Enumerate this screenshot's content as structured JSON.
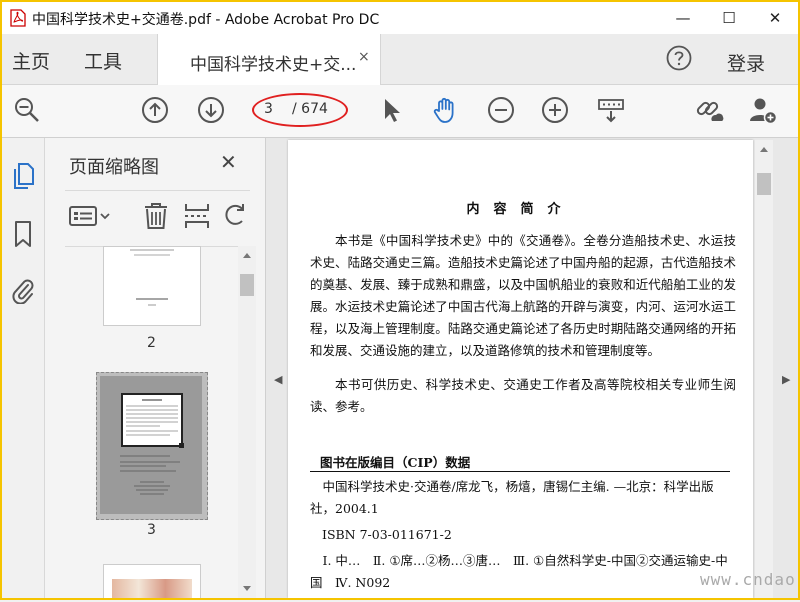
{
  "window": {
    "title": "中国科学技术史+交通卷.pdf - Adobe Acrobat Pro DC",
    "minimize": "—",
    "maximize": "☐",
    "close": "✕"
  },
  "tabs": {
    "home": "主页",
    "tools": "工具",
    "document": "中国科学技术史+交...",
    "document_close": "×",
    "login": "登录"
  },
  "toolbar": {
    "page_current": "3",
    "page_total": "/ 674",
    "accent_color": "#2b72c8",
    "annotation_color": "#e02020"
  },
  "panel": {
    "title": "页面缩略图",
    "close": "✕",
    "thumbnails": [
      {
        "label": "2"
      },
      {
        "label": "3"
      }
    ]
  },
  "document": {
    "heading": "内容简介",
    "paragraph1": "本书是《中国科学技术史》中的《交通卷》。全卷分造船技术史、水运技术史、陆路交通史三篇。造船技术史篇论述了中国舟船的起源，古代造船技术的奠基、发展、臻于成熟和鼎盛，以及中国帆船业的衰败和近代船舶工业的发展。水运技术史篇论述了中国古代海上航路的开辟与演变，内河、运河水运工程，以及海上管理制度。陆路交通史篇论述了各历史时期陆路交通网络的开拓和发展、交通设施的建立，以及道路修筑的技术和管理制度等。",
    "paragraph2": "本书可供历史、科学技术史、交通史工作者及高等院校相关专业师生阅读、参考。",
    "cip_heading": "图书在版编目（CIP）数据",
    "cip_line1": "中国科学技术史·交通卷/席龙飞，杨熺，唐锡仁主编. —北京：科学出版社，2004.1",
    "cip_isbn": "ISBN 7-03-011671-2",
    "cip_subjects": "Ⅰ. 中…　Ⅱ. ①席…②杨…③唐…　Ⅲ. ①自然科学史-中国②交通运输史-中国　Ⅳ. N092"
  },
  "watermark": "www.cndao.com"
}
